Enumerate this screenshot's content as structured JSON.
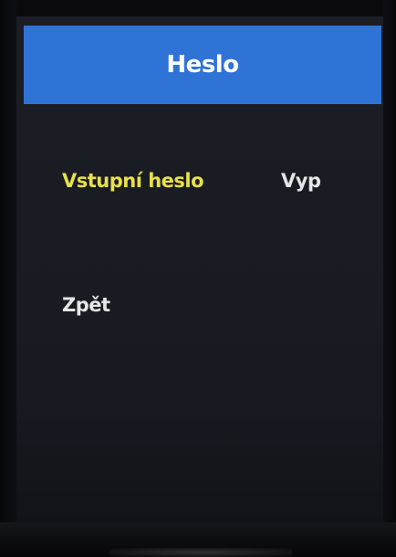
{
  "header": {
    "title": "Heslo"
  },
  "menu": {
    "items": [
      {
        "label": "Vstupní heslo",
        "value": "Vyp",
        "state": "selected"
      },
      {
        "label": "Zpět"
      }
    ]
  },
  "colors": {
    "header_bg": "#2f73d6",
    "selected_text": "#e8e04a",
    "text": "#e6e6e6",
    "background": "#1a1c24"
  }
}
